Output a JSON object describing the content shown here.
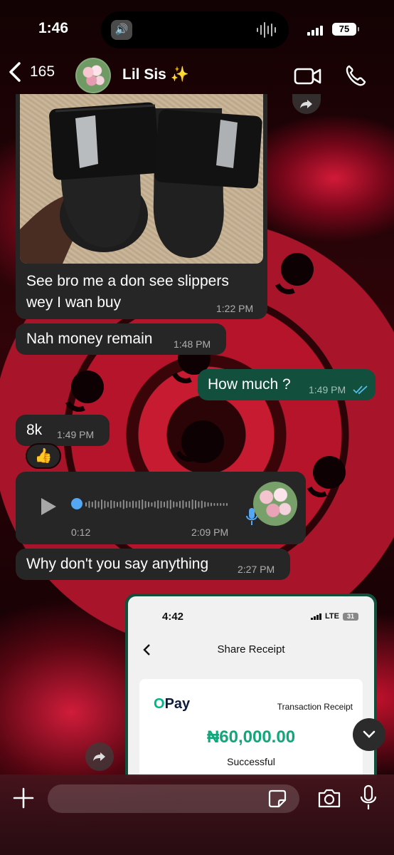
{
  "status_bar": {
    "time": "1:46",
    "battery": "75"
  },
  "header": {
    "back_count": "165",
    "contact_name": "Lil Sis ✨"
  },
  "messages": [
    {
      "id": "m1",
      "direction": "in",
      "type": "photo",
      "caption_line1": "See bro me a don see slippers",
      "caption_line2": "wey I wan buy",
      "time": "1:22 PM"
    },
    {
      "id": "m2",
      "direction": "in",
      "type": "text",
      "text": "Nah money remain",
      "time": "1:48 PM"
    },
    {
      "id": "m3",
      "direction": "out",
      "type": "text",
      "text": "How much ?",
      "time": "1:49 PM",
      "read": true
    },
    {
      "id": "m4",
      "direction": "in",
      "type": "text",
      "text": "8k",
      "time": "1:49 PM",
      "reaction": "👍"
    },
    {
      "id": "m5",
      "direction": "in",
      "type": "voice",
      "duration": "0:12",
      "time": "2:09 PM",
      "progress": 0
    },
    {
      "id": "m6",
      "direction": "in",
      "type": "text",
      "text": "Why don't you say anything",
      "time": "2:27 PM"
    },
    {
      "id": "m7",
      "direction": "out",
      "type": "image"
    }
  ],
  "receipt": {
    "time": "4:42",
    "network": "LTE",
    "battery": "31",
    "title": "Share Receipt",
    "brand": "Pay",
    "brand_prefix": "O",
    "subtitle": "Transaction Receipt",
    "amount": "₦60,000.00",
    "result": "Successful"
  },
  "colors": {
    "outgoing_bubble": "#124f3d",
    "incoming_bubble": "#262626",
    "read_ticks": "#53bdeb",
    "voice_dot": "#53a7f5",
    "opay_green": "#10a77a"
  },
  "composer": {
    "placeholder": ""
  },
  "icons": {
    "back": "chevron-left-icon",
    "video": "video-camera-icon",
    "phone": "phone-icon",
    "play": "play-icon",
    "mic": "microphone-icon",
    "camera": "camera-icon",
    "sticker": "sticker-icon",
    "add": "plus-icon",
    "forward": "forward-icon",
    "scroll": "chevron-down-icon"
  }
}
